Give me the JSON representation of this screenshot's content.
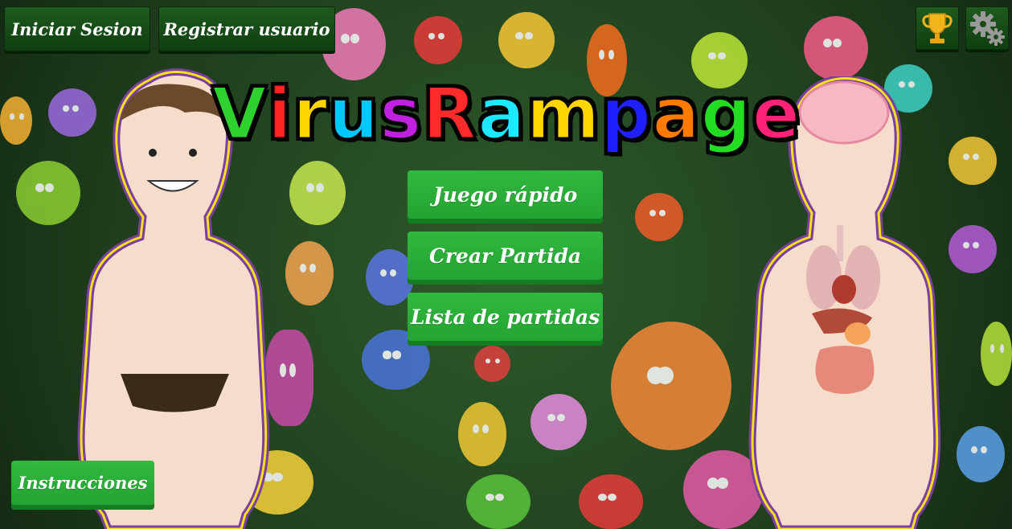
{
  "header": {
    "login_label": "Iniciar Sesion",
    "register_label": "Registrar usuario",
    "trophy_icon": "trophy-icon",
    "settings_icon": "gears-icon"
  },
  "title": {
    "letters": [
      "V",
      "i",
      "r",
      "u",
      "s",
      " ",
      "R",
      "a",
      "m",
      "p",
      "a",
      "g",
      "e"
    ],
    "colors": [
      "#2ed12e",
      "#ff2222",
      "#ffd400",
      "#00c8ff",
      "#c020e0",
      "#000",
      "#ff2a2a",
      "#1ee8ff",
      "#ffd500",
      "#2020ff",
      "#ff7a00",
      "#22dd22",
      "#ff2277"
    ]
  },
  "menu": {
    "quick_game": "Juego rápido",
    "create_game": "Crear Partida",
    "game_list": "Lista de partidas"
  },
  "footer": {
    "instructions_label": "Instrucciones"
  }
}
